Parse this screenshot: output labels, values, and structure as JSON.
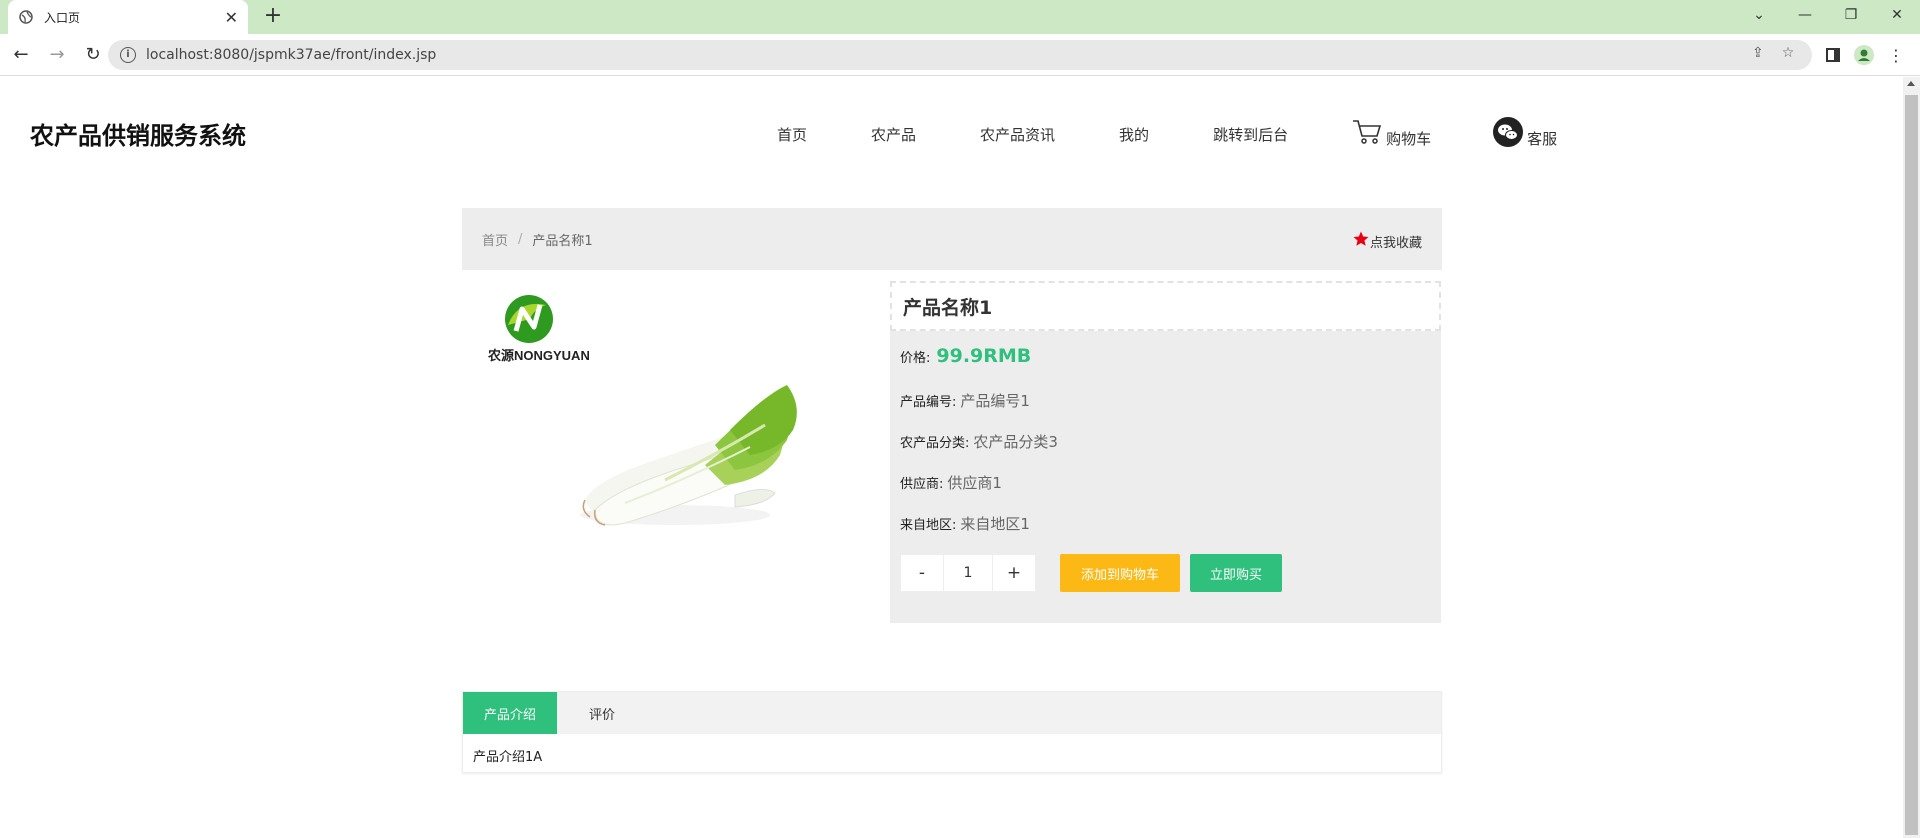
{
  "browser": {
    "tab_title": "入口页",
    "url": "localhost:8080/jspmk37ae/front/index.jsp"
  },
  "site": {
    "title": "农产品供销服务系统",
    "nav": [
      "首页",
      "农产品",
      "农产品资讯",
      "我的",
      "跳转到后台"
    ],
    "cart_label": "购物车",
    "service_label": "客服"
  },
  "breadcrumb": {
    "home": "首页",
    "sep": "/",
    "current": "产品名称1",
    "favorite": "点我收藏"
  },
  "product": {
    "name": "产品名称1",
    "logo_text": "农源NONGYUAN",
    "price_label": "价格:",
    "price": "99.9RMB",
    "code_label": "产品编号:",
    "code": "产品编号1",
    "category_label": "农产品分类:",
    "category": "农产品分类3",
    "supplier_label": "供应商:",
    "supplier": "供应商1",
    "region_label": "来自地区:",
    "region": "来自地区1",
    "qty_minus": "-",
    "qty": "1",
    "qty_plus": "+",
    "add_to_cart": "添加到购物车",
    "buy_now": "立即购买"
  },
  "tabs": {
    "intro": "产品介绍",
    "review": "评价",
    "intro_content": "产品介绍1A"
  },
  "colors": {
    "accent": "#2fc07e",
    "cart_button": "#fcb815",
    "favorite_star": "#e60012"
  }
}
